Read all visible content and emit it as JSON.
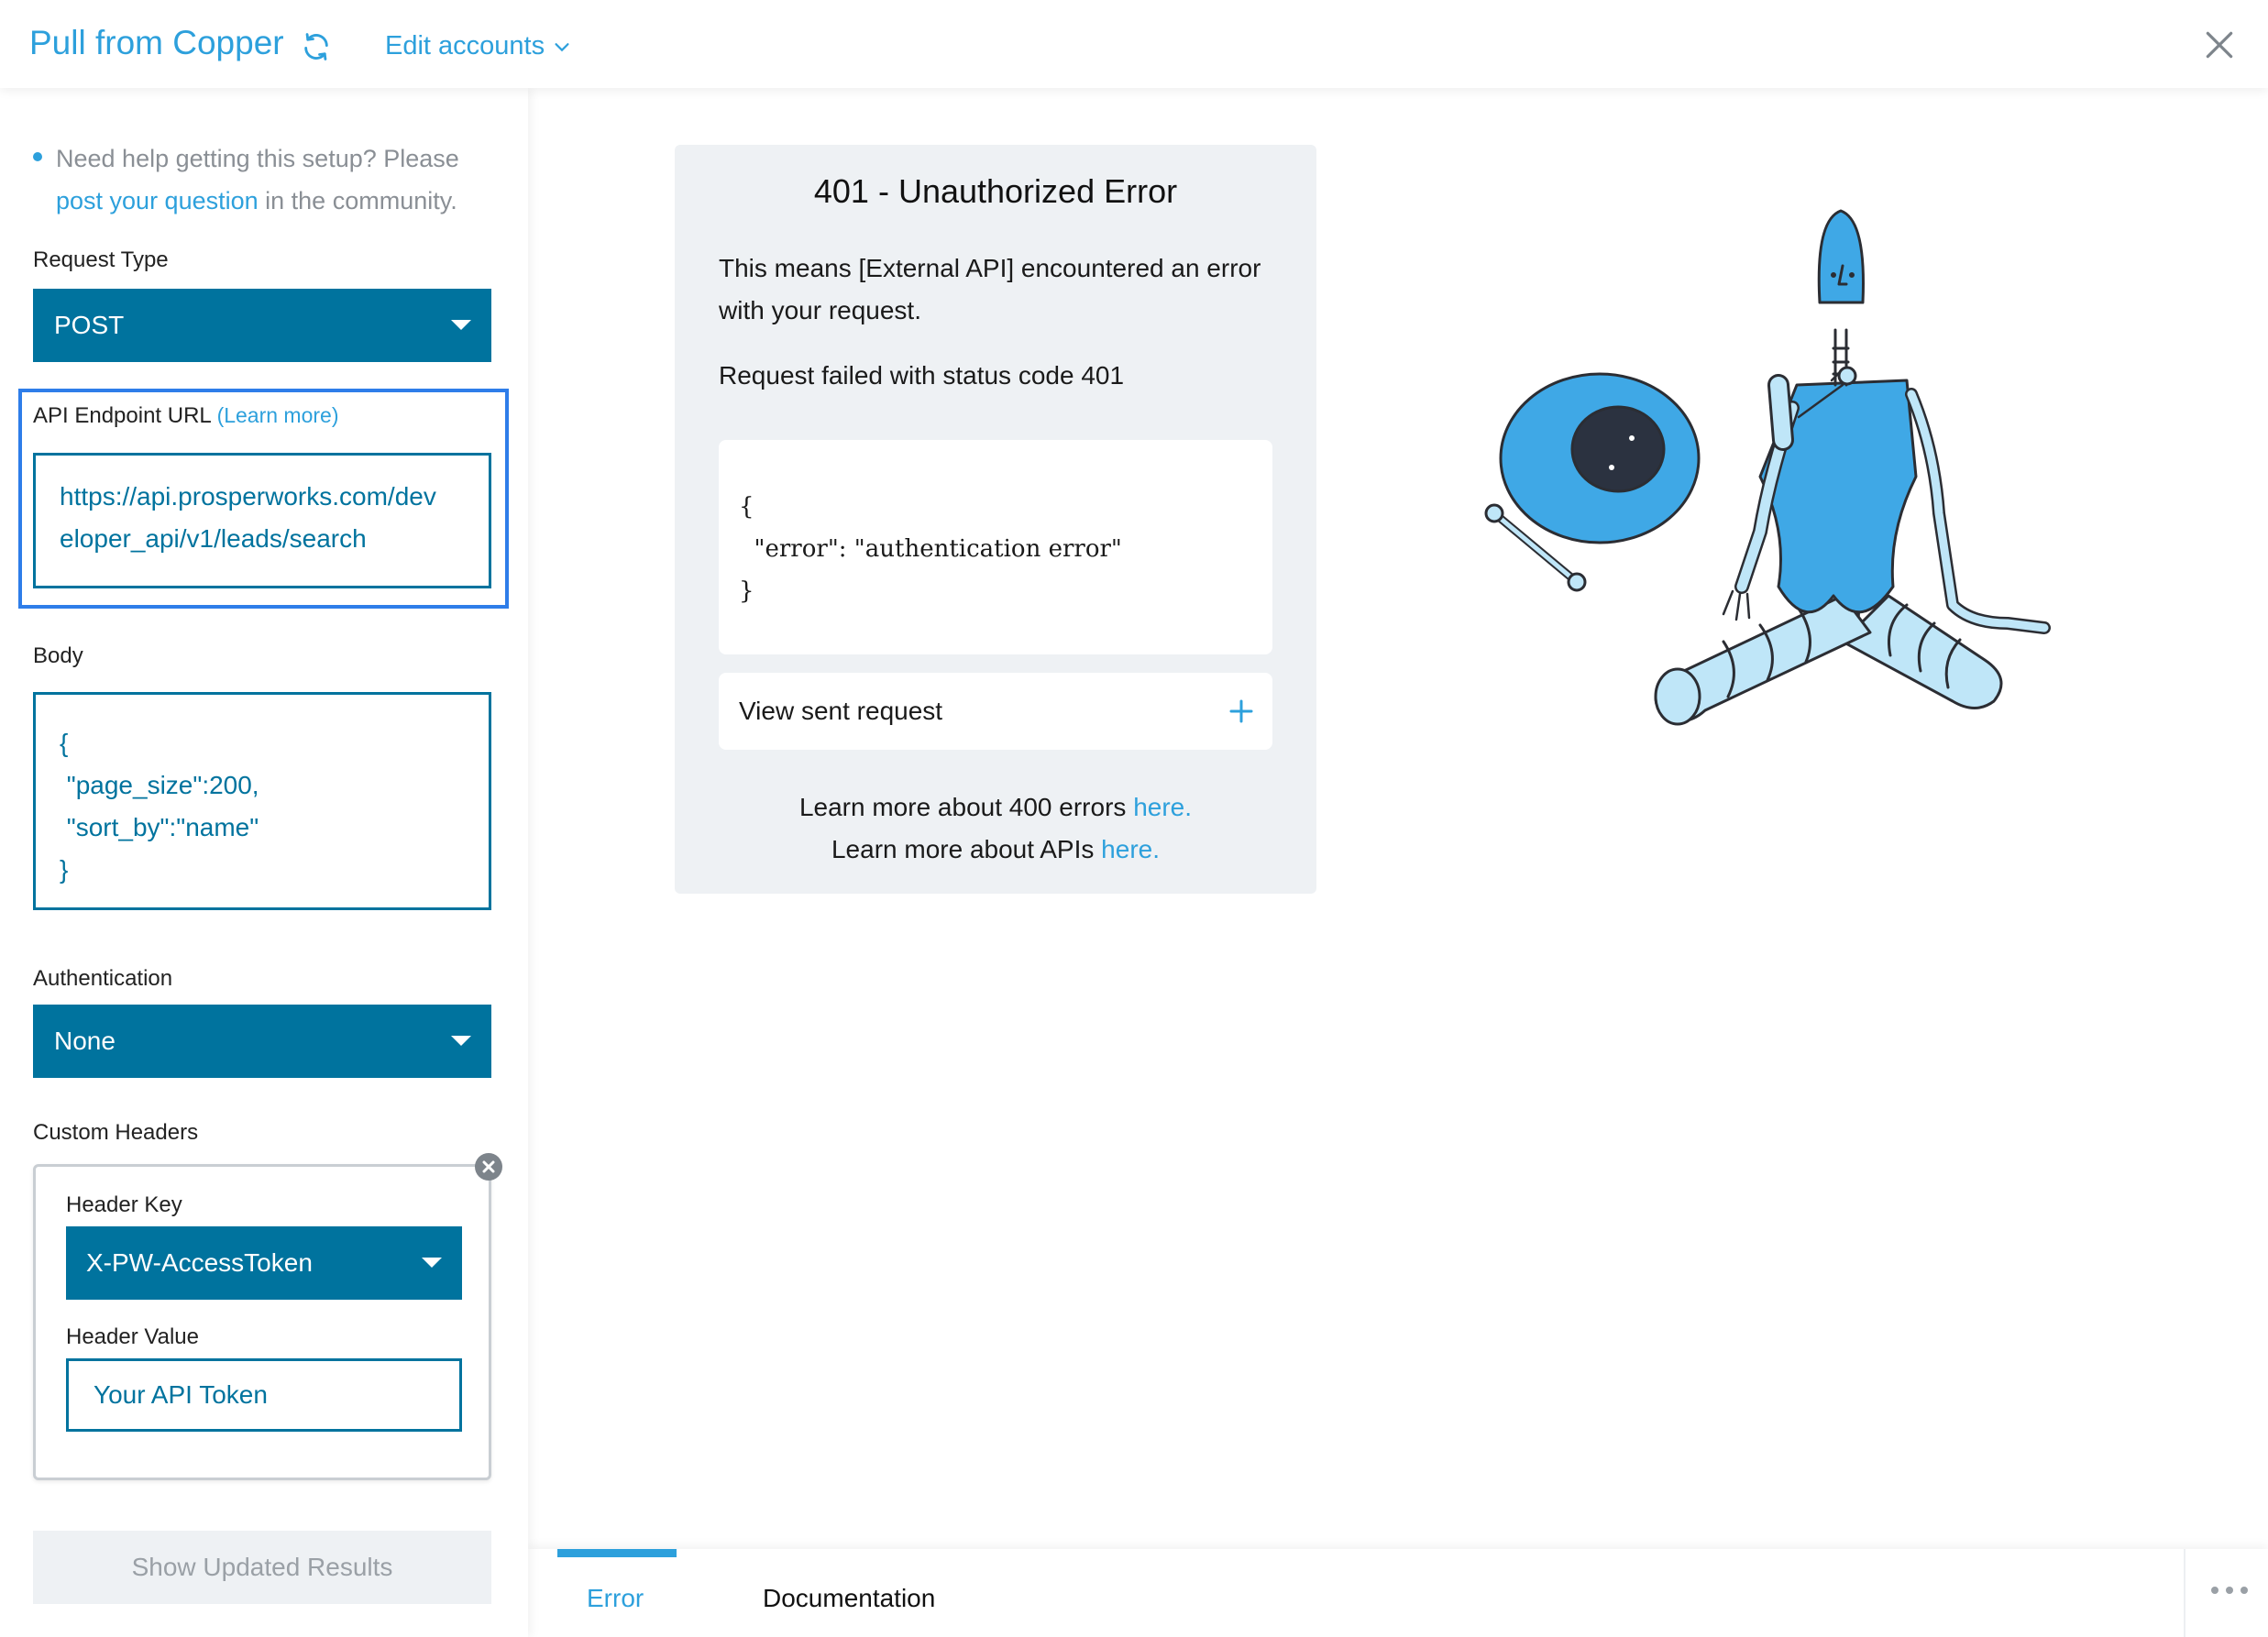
{
  "header": {
    "title": "Pull from Copper",
    "edit_accounts": "Edit accounts",
    "icons": {
      "refresh": "refresh-icon",
      "chevron": "chevron-down-icon",
      "close": "close-icon"
    }
  },
  "sidebar": {
    "help_prefix": "Need help getting this setup? Please",
    "help_link": "post your question",
    "help_suffix": " in the community.",
    "request_type_label": "Request Type",
    "request_type_value": "POST",
    "endpoint_label": "API Endpoint URL",
    "endpoint_learn_more": "(Learn more)",
    "endpoint_line1": "https://api.prosperworks.com/dev",
    "endpoint_line2": "eloper_api/v1/leads/search",
    "body_label": "Body",
    "body_lines": [
      "{",
      " \"page_size\":200,",
      " \"sort_by\":\"name\"",
      "}"
    ],
    "auth_label": "Authentication",
    "auth_value": "None",
    "custom_headers_label": "Custom Headers",
    "header_key_label": "Header Key",
    "header_key_value": "X-PW-AccessToken",
    "header_value_label": "Header Value",
    "header_value_value": "Your API Token",
    "show_results": "Show Updated Results"
  },
  "error": {
    "title": "401 - Unauthorized Error",
    "description": "This means [External API] encountered an error with your request.",
    "status": "Request failed with status code 401",
    "code_lines": [
      "{",
      "  \"error\": \"authentication error\"",
      "}"
    ],
    "view_request": "View sent request",
    "learn_400_prefix": "Learn more about 400 errors ",
    "learn_400_link": "here.",
    "learn_api_prefix": "Learn more about APIs ",
    "learn_api_link": "here."
  },
  "tabs": {
    "error": "Error",
    "documentation": "Documentation",
    "active": "Error"
  },
  "colors": {
    "accent": "#2da0dc",
    "select_bg": "#00739e",
    "focus": "#2e7de9",
    "card_bg": "#eef1f4"
  }
}
